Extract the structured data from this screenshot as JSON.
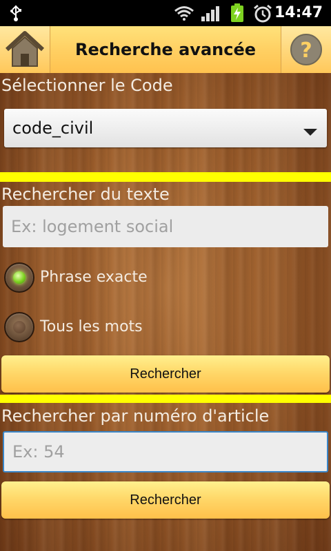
{
  "status_bar": {
    "time": "14:47"
  },
  "header": {
    "title": "Recherche avancée"
  },
  "code_section": {
    "label": "Sélectionner le Code",
    "selected": "code_civil"
  },
  "text_search": {
    "label": "Rechercher du texte",
    "placeholder": "Ex: logement social",
    "options": [
      {
        "label": "Phrase exacte",
        "selected": true
      },
      {
        "label": "Tous les mots",
        "selected": false
      }
    ],
    "button_label": "Rechercher"
  },
  "article_search": {
    "label": "Rechercher par numéro d'article",
    "placeholder": "Ex: 54",
    "button_label": "Rechercher"
  },
  "colors": {
    "header": "#ffd063",
    "separator": "#ffff00",
    "radio_on": "#7ed321",
    "field_focus": "#3a86c8"
  }
}
